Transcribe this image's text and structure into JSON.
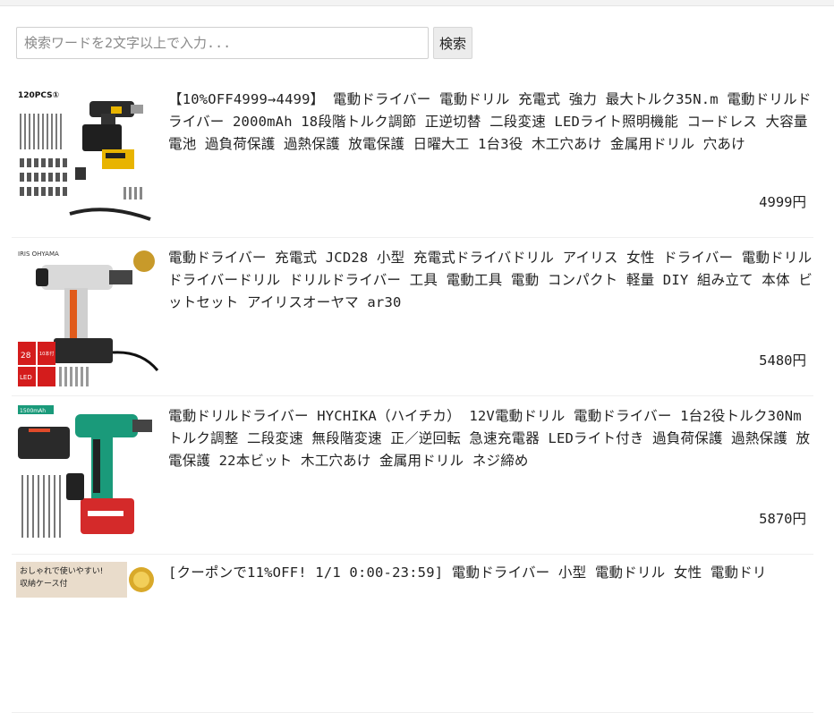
{
  "search": {
    "placeholder": "検索ワードを2文字以上で入力...",
    "button_label": "検索"
  },
  "products": [
    {
      "title": "【10%OFF4999→4499】 電動ドライバー 電動ドリル 充電式 強力 最大トルク35N.m 電動ドリルドライバー 2000mAh 18段階トルク調節 正逆切替 二段変速 LEDライト照明機能 コードレス 大容量電池 過負荷保護 過熱保護 放電保護 日曜大工 1台3役 木工穴あけ 金属用ドリル 穴あけ",
      "price": "4999円",
      "image_text": [
        "120PCS①"
      ]
    },
    {
      "title": "電動ドライバー 充電式 JCD28 小型 充電式ドライバドリル アイリス 女性 ドライバー 電動ドリル ドライバードリル ドリルドライバー 工具 電動工具 電動 コンパクト 軽量 DIY 組み立て 本体 ビットセット アイリスオーヤマ ar30",
      "price": "5480円",
      "image_text": [
        "IRIS OHYAMA",
        "28",
        "LED",
        "10本付"
      ]
    },
    {
      "title": "電動ドリルドライバー HYCHIKA（ハイチカ） 12V電動ドリル 電動ドライバー 1台2役トルク30Nm トルク調整 二段変速 無段階変速 正／逆回転 急速充電器 LEDライト付き 過負荷保護 過熱保護 放電保護 22本ビット 木工穴あけ 金属用ドリル ネジ締め",
      "price": "5870円",
      "image_text": [
        "1500mAh"
      ]
    },
    {
      "title": "[クーポンで11%OFF! 1/1 0:00-23:59] 電動ドライバー 小型 電動ドリル 女性 電動ドリ",
      "price": "",
      "image_text": [
        "おしゃれで使いやすい!",
        "収納ケース付"
      ]
    }
  ],
  "colors": {
    "drill1_accent": "#e8b400",
    "drill2_accent": "#e05a1a",
    "drill3_accent": "#1a9a7a",
    "badge_red": "#d41c1c"
  }
}
